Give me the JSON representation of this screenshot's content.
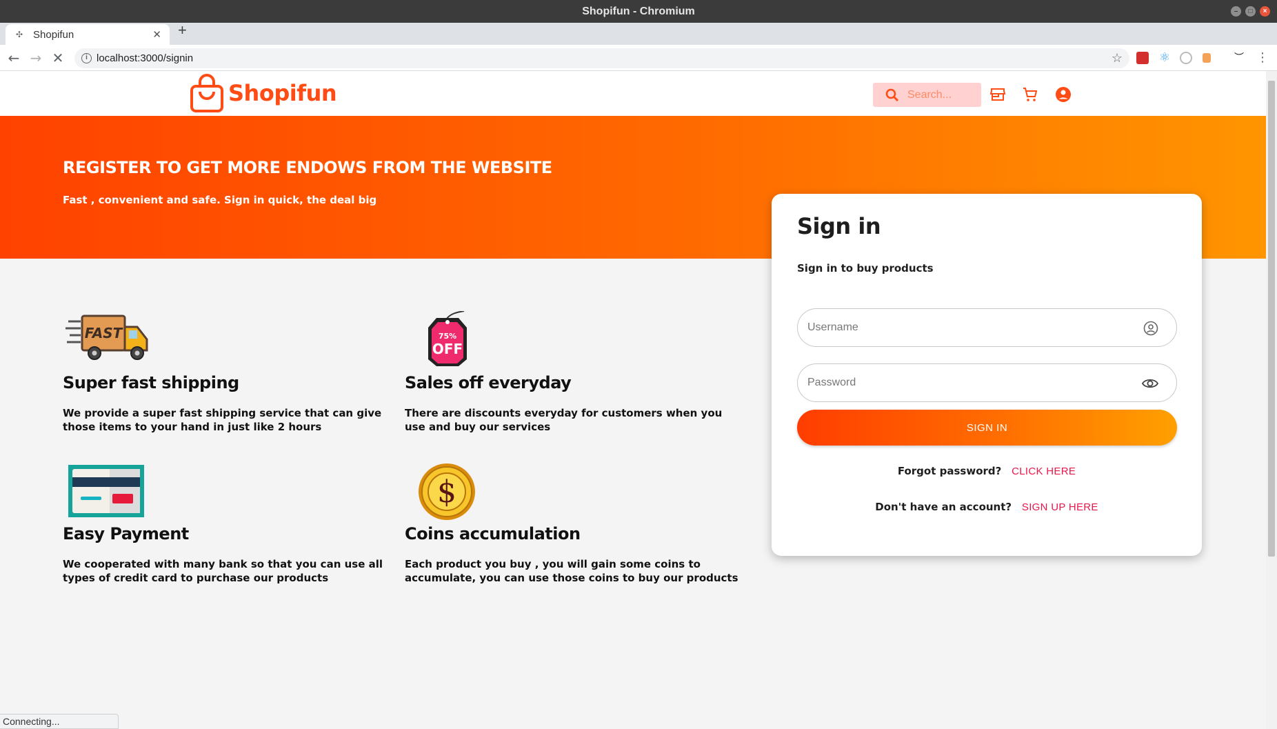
{
  "window": {
    "title": "Shopifun - Chromium"
  },
  "browser": {
    "tab_title": "Shopifun",
    "url": "localhost:3000/signin",
    "status_text": "Connecting..."
  },
  "header": {
    "brand": "Shopifun",
    "search_placeholder": "Search...",
    "icons": [
      "search-icon",
      "store-icon",
      "cart-icon",
      "account-icon"
    ]
  },
  "banner": {
    "title": "REGISTER TO GET MORE ENDOWS FROM THE WEBSITE",
    "subtitle": "Fast , convenient and safe. Sign in quick, the deal big"
  },
  "features": [
    {
      "icon": "fast-truck-icon",
      "title": "Super fast shipping",
      "description": "We provide a super fast shipping service that can give those items to your hand in just like 2 hours"
    },
    {
      "icon": "discount-tag-icon",
      "title": "Sales off everyday",
      "description": "There are discounts everyday for customers when you use and buy our services",
      "tag_top": "75%",
      "tag_bottom": "OFF"
    },
    {
      "icon": "credit-card-icon",
      "title": "Easy Payment",
      "description": "We cooperated with many bank so that you can use all types of credit card to purchase our products"
    },
    {
      "icon": "coin-icon",
      "title": "Coins accumulation",
      "description": "Each product you buy , you will gain some coins to accumulate, you can use those coins to buy our products"
    }
  ],
  "signin": {
    "title": "Sign in",
    "subtitle": "Sign in to buy products",
    "username_placeholder": "Username",
    "password_placeholder": "Password",
    "button_label": "SIGN IN",
    "forgot_text": "Forgot password?",
    "forgot_link": "CLICK HERE",
    "signup_text": "Don't have an account?",
    "signup_link": "SIGN UP HERE"
  },
  "colors": {
    "brand": "#ff4b14",
    "link": "#e8174a",
    "search_bg": "#ffd1d1"
  }
}
